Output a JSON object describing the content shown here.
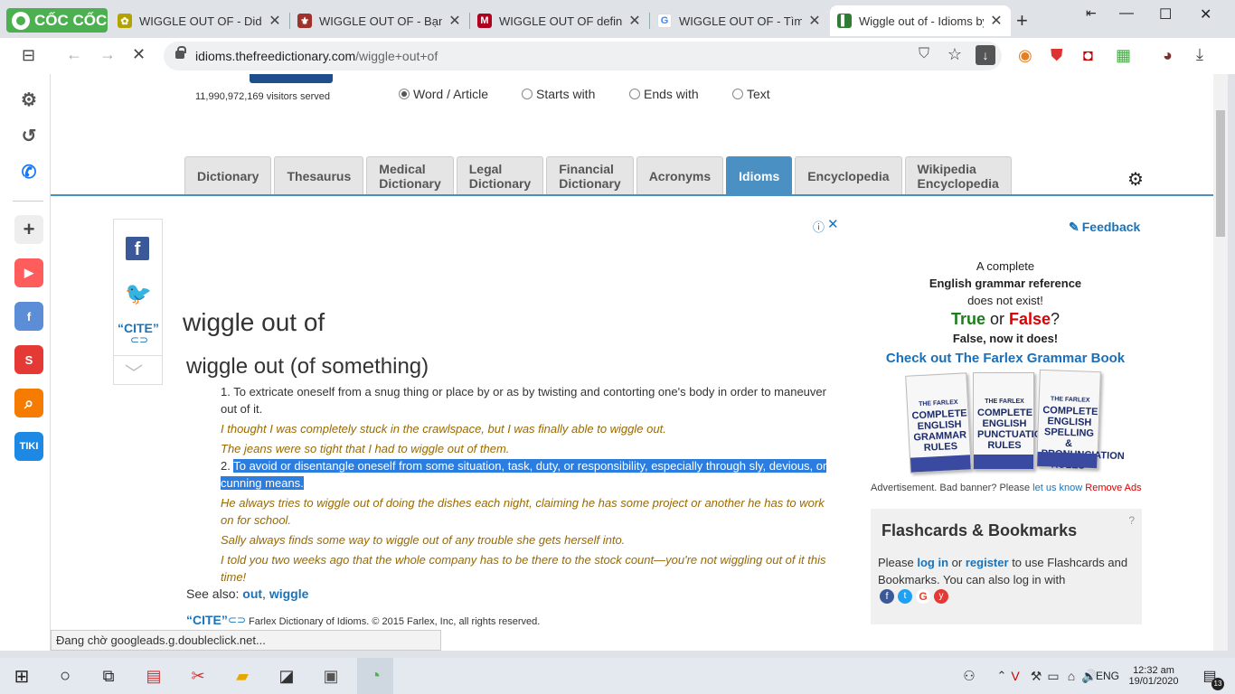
{
  "browser": {
    "brand": "CỐC CỐC",
    "tabs": [
      {
        "title": "WIGGLE OUT OF - Did you",
        "color": "#b3a200",
        "glyph": "✿"
      },
      {
        "title": "WIGGLE OUT OF - Bạn đã c",
        "color": "#a0302a",
        "glyph": "⚜"
      },
      {
        "title": "WIGGLE OUT OF definition",
        "color": "#b00020",
        "glyph": "M"
      },
      {
        "title": "WIGGLE OUT OF - Tìm với C",
        "color": "#4285f4",
        "glyph": "G"
      },
      {
        "title": "Wiggle out of - Idioms by T",
        "color": "#2e7d32",
        "glyph": "▌"
      }
    ],
    "url_domain": "idioms.thefreedictionary.com",
    "url_path": "/wiggle+out+of",
    "status": "Đang chờ googleads.g.doubleclick.net..."
  },
  "site": {
    "visitors": "11,990,972,169 visitors served",
    "search_modes": [
      "Word / Article",
      "Starts with",
      "Ends with",
      "Text"
    ],
    "nav_tabs": [
      [
        "Dictionary"
      ],
      [
        "Thesaurus"
      ],
      [
        "Medical",
        "Dictionary"
      ],
      [
        "Legal",
        "Dictionary"
      ],
      [
        "Financial",
        "Dictionary"
      ],
      [
        "Acronyms"
      ],
      [
        "Idioms"
      ],
      [
        "Encyclopedia"
      ],
      [
        "Wikipedia",
        "Encyclopedia"
      ]
    ],
    "active_tab": "Idioms"
  },
  "share": {
    "cite": "“CITE”"
  },
  "entry": {
    "headword": "wiggle out of",
    "subhead": "wiggle out (of something)",
    "def1_num": "1.",
    "def1": "To extricate oneself from a snug thing or place by or as by twisting and contorting one's body in order to maneuver out of it.",
    "ex1": "I thought I was completely stuck in the crawlspace, but I was finally able to wiggle out.",
    "ex2": "The jeans were so tight that I had to wiggle out of them.",
    "def2_num": "2.",
    "def2": "To avoid or disentangle oneself from some situation, task, duty, or responsibility, especially through sly, devious, or cunning means.",
    "ex3": "He always tries to wiggle out of doing the dishes each night, claiming he has some project or another he has to work on for school.",
    "ex4": "Sally always finds some way to wiggle out of any trouble she gets herself into.",
    "ex5": "I told you two weeks ago that the whole company has to be there to the stock count—you're not wiggling out of it this time!",
    "see_also_label": "See also:",
    "see_also_1": "out",
    "see_also_sep": ",",
    "see_also_2": "wiggle",
    "cite": "“CITE”",
    "copyright": "Farlex Dictionary of Idioms. © 2015 Farlex, Inc, all rights reserved."
  },
  "ad": {
    "line1": "A complete",
    "line2": "English grammar reference",
    "line3": "does not exist!",
    "true": "True",
    "or": "or",
    "false": "False",
    "q": "?",
    "line5": "False, now it does!",
    "cta": "Check out The Farlex Grammar Book",
    "books": [
      [
        "THE FARLEX",
        "COMPLETE ENGLISH GRAMMAR RULES"
      ],
      [
        "THE FARLEX",
        "COMPLETE ENGLISH PUNCTUATION RULES"
      ],
      [
        "THE FARLEX",
        "COMPLETE ENGLISH SPELLING & PRONUNCIATION RULES"
      ]
    ],
    "footer": "Advertisement. Bad banner? Please",
    "let_us_know": "let us know",
    "remove": "Remove Ads"
  },
  "feedback": "Feedback",
  "flash": {
    "title": "Flashcards & Bookmarks",
    "help": "?",
    "t1": "Please",
    "login": "log in",
    "or": "or",
    "register": "register",
    "t2": "to use Flashcards and Bookmarks. You can also log in with"
  },
  "taskbar": {
    "lang": "ENG",
    "time": "12:32 am",
    "date": "19/01/2020",
    "badge": "13"
  }
}
